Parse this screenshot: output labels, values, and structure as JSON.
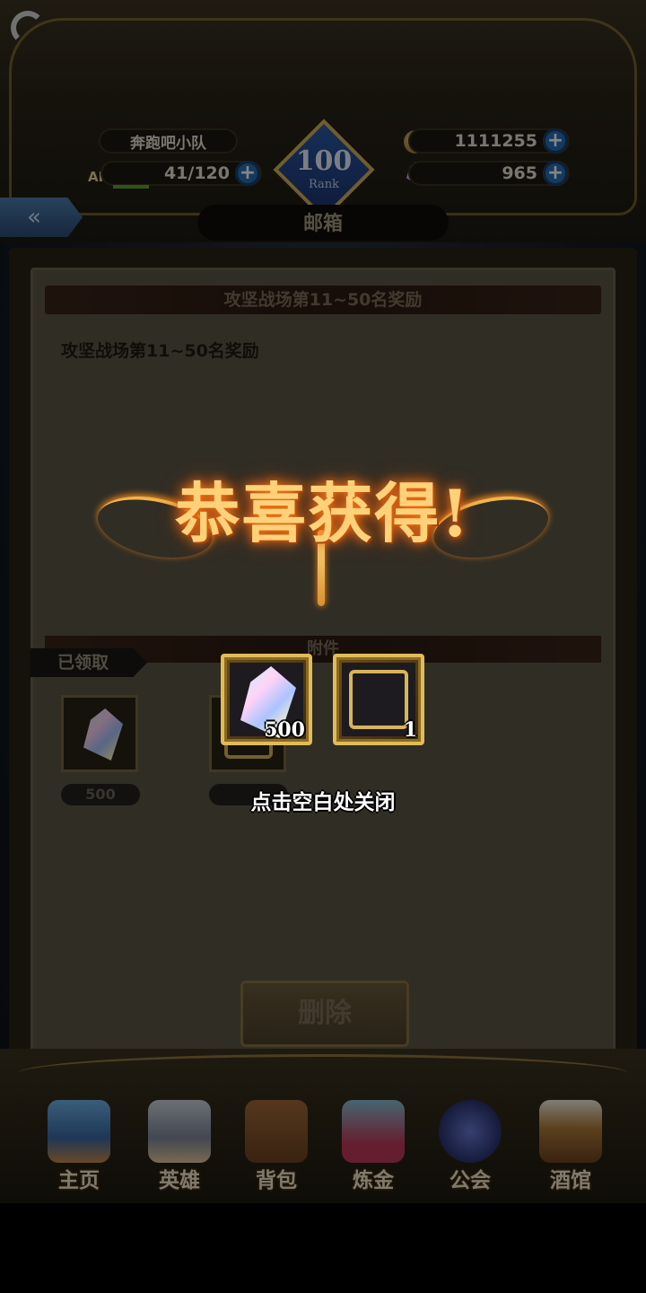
{
  "header": {
    "team_name": "奔跑吧小队",
    "ap_label": "AP",
    "ap_value": "41/120",
    "gold": "1111255",
    "gems": "965",
    "rank_number": "100",
    "rank_label": "Rank",
    "page_title": "邮箱"
  },
  "mail": {
    "title": "攻坚战场第11~50名奖励",
    "body": "攻坚战场第11~50名奖励",
    "attachments_header": "附件",
    "claimed_label": "已领取",
    "attachments": [
      {
        "icon": "crystal-gem-icon",
        "count": "500"
      },
      {
        "icon": "avatar-frame-icon",
        "count": "1"
      }
    ],
    "delete_label": "删除"
  },
  "popup": {
    "title": "恭喜获得!",
    "rewards": [
      {
        "icon": "crystal-gem-icon",
        "count": "500"
      },
      {
        "icon": "avatar-frame-icon",
        "count": "1"
      }
    ],
    "close_hint": "点击空白处关闭"
  },
  "nav": [
    {
      "label": "主页",
      "icon": "castle-icon"
    },
    {
      "label": "英雄",
      "icon": "knight-helmet-icon"
    },
    {
      "label": "背包",
      "icon": "backpack-icon"
    },
    {
      "label": "炼金",
      "icon": "potion-flask-icon"
    },
    {
      "label": "公会",
      "icon": "guild-shield-icon"
    },
    {
      "label": "酒馆",
      "icon": "beer-barrel-icon"
    }
  ],
  "colors": {
    "gold_accent": "#d7b35a",
    "popup_title_glow": "#ff7a18",
    "plus_button": "#2a6fb8"
  }
}
